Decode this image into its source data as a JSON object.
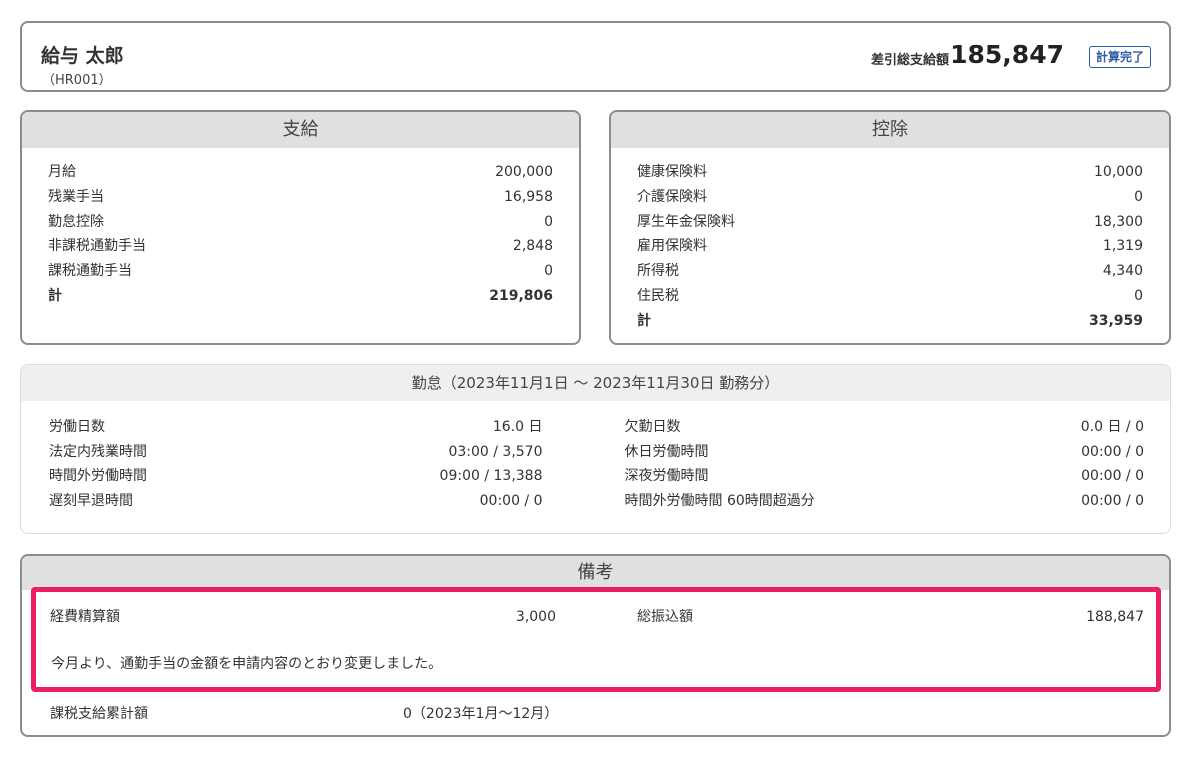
{
  "header": {
    "employee_name": "給与 太郎",
    "employee_code": "（HR001）",
    "net_label": "差引総支給額",
    "net_amount": "185,847",
    "status": "計算完了"
  },
  "payments": {
    "title": "支給",
    "items": [
      {
        "label": "月給",
        "value": "200,000"
      },
      {
        "label": "残業手当",
        "value": "16,958"
      },
      {
        "label": "勤怠控除",
        "value": "0"
      },
      {
        "label": "非課税通勤手当",
        "value": "2,848"
      },
      {
        "label": "課税通勤手当",
        "value": "0"
      }
    ],
    "total_label": "計",
    "total_value": "219,806"
  },
  "deductions": {
    "title": "控除",
    "items": [
      {
        "label": "健康保険料",
        "value": "10,000"
      },
      {
        "label": "介護保険料",
        "value": "0"
      },
      {
        "label": "厚生年金保険料",
        "value": "18,300"
      },
      {
        "label": "雇用保険料",
        "value": "1,319"
      },
      {
        "label": "所得税",
        "value": "4,340"
      },
      {
        "label": "住民税",
        "value": "0"
      }
    ],
    "total_label": "計",
    "total_value": "33,959"
  },
  "attendance": {
    "title": "勤怠（2023年11月1日 〜 2023年11月30日 勤務分）",
    "left": [
      {
        "label": "労働日数",
        "value": "16.0 日"
      },
      {
        "label": "法定内残業時間",
        "value": "03:00 / 3,570"
      },
      {
        "label": "時間外労働時間",
        "value": "09:00 / 13,388"
      },
      {
        "label": "遅刻早退時間",
        "value": "00:00 / 0"
      }
    ],
    "right": [
      {
        "label": "欠勤日数",
        "value": "0.0 日 / 0"
      },
      {
        "label": "休日労働時間",
        "value": "00:00 / 0"
      },
      {
        "label": "深夜労働時間",
        "value": "00:00 / 0"
      },
      {
        "label": "時間外労働時間 60時間超過分",
        "value": "00:00 / 0"
      }
    ]
  },
  "notes": {
    "title": "備考",
    "expense_label": "経費精算額",
    "expense_value": "3,000",
    "transfer_label": "総振込額",
    "transfer_value": "188,847",
    "message": "今月より、通勤手当の金額を申請内容のとおり変更しました。",
    "ytd_label": "課税支給累計額",
    "ytd_value": "0（2023年1月〜12月）"
  },
  "colors": {
    "highlight": "#e91e63",
    "badge": "#2f5ea8",
    "header_bg": "#e0e0e0"
  }
}
